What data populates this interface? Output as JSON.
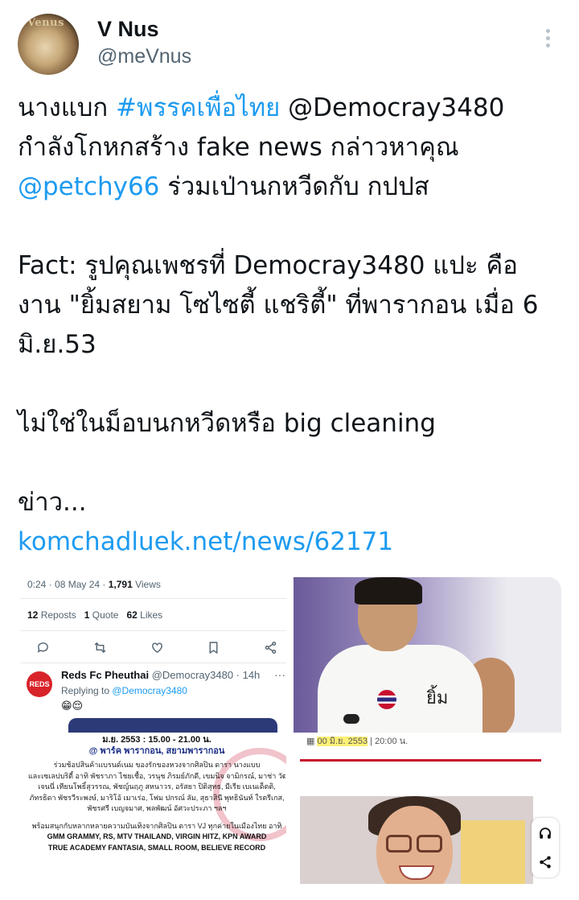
{
  "author": {
    "avatar_text": "Venus",
    "display_name": "V Nus",
    "handle": "@meVnus"
  },
  "tweet": {
    "l1_a": "นางแบก ",
    "l1_hashtag": "#พรรคเพื่อไทย",
    "l1_b": " @Democray3480",
    "l2": "กำลังโกหกสร้าง fake news กล่าวหาคุณ",
    "l3_mention": "@petchy66",
    "l3_b": " ร่วมเป่านกหวีดกับ กปปส",
    "l4": "Fact: รูปคุณเพชรที่ Democray3480 แปะ คือ",
    "l5": "งาน \"ยิ้มสยาม โซไซตี้ แชริตี้\" ที่พารากอน เมื่อ 6",
    "l6": "มิ.ย.53",
    "l7": "ไม่ใช่ในม็อบนกหวีดหรือ big cleaning",
    "l8": "ข่าว...",
    "link": "komchadluek.net/news/62171"
  },
  "quoted": {
    "time": "0:24 · 08 May 24 · ",
    "views_count": "1,791",
    "views_label": " Views",
    "reposts_count": "12",
    "reposts_label": " Reposts",
    "quotes_count": "1",
    "quotes_label": " Quote",
    "likes_count": "62",
    "likes_label": " Likes",
    "reply_author_logo": "REDS",
    "reply_author_name": "Reds Fc Pheuthai",
    "reply_author_meta": " @Democray3480 · 14h",
    "reply_more": "···",
    "replying_label": "Replying to ",
    "replying_handle": "@Democray3480",
    "reply_emoji": "😁😌"
  },
  "photo_shirt_text": "ยิ้ม",
  "poster": {
    "lines": [
      "ม.ย. 2553 : 15.00 - 21.00 น.",
      "@ พาร์ค พารากอน, สยามพารากอน",
      "ร่วมช้อปสินค้าแบรนด์เนม ของรักของหวงจากศิลปิน ดารา นางแบบ",
      "และเซเลปบริตี้ อาทิ พัชราภา ไชยเชื้อ, วรนุช ภิรมย์ภักดี, เขมนิจ จามิกรณ์, มาช่า วัฒนพานิช,",
      "เจนนี่ เทียนโพธิ์สุวรรณ, พัชญ์นฤภู สหนาวร, อรัสยา ปิติสุทธ, มีเรีย เบเนเด็ตติ,",
      "ภัทรธิดา พัชรวีระพงษ์, มาริโอ้ เมาเร่อ, โฟม ปกรณ์ ลัม, สุธาสินี พุทธินันท์ ใรตรีเกส,",
      "พัชรศรี เบญจมาศ, พลพัฒน์ อัศวะประภา ฯลฯ",
      "พร้อมสนุกกับหลากหลายความบันเทิงจากศิลปิน ดารา VJ ทุกค่ายในเมืองไทย อาทิ",
      "GMM GRAMMY, RS, MTV THAILAND, VIRGIN HITZ, KPN AWARD",
      "TRUE ACADEMY FANTASIA, SMALL ROOM, BELIEVE RECORD"
    ]
  },
  "news": {
    "date_hl": "00 มิ.ย. 2553",
    "date_rest": " | 20:00 น."
  }
}
